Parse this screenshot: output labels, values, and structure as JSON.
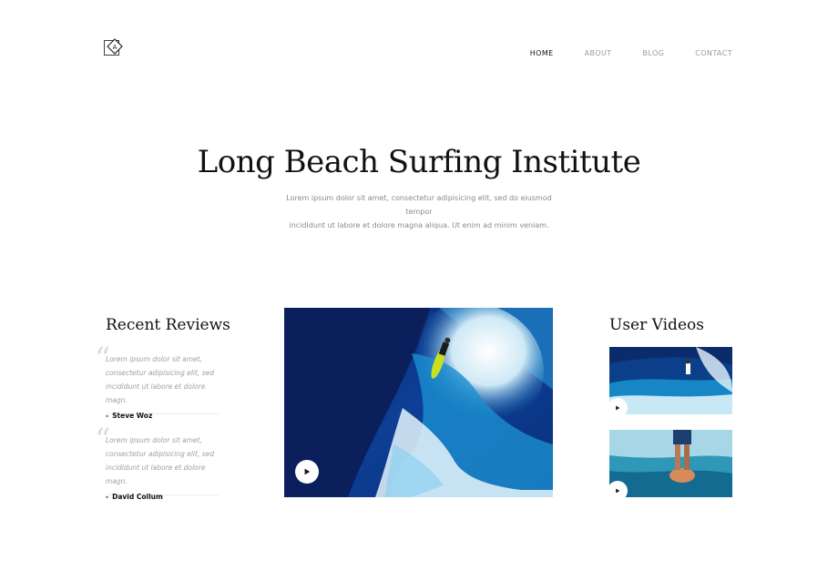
{
  "nav": {
    "items": [
      {
        "label": "HOME",
        "active": true
      },
      {
        "label": "ABOUT",
        "active": false
      },
      {
        "label": "BLOG",
        "active": false
      },
      {
        "label": "CONTACT",
        "active": false
      }
    ]
  },
  "hero": {
    "title": "Long Beach Surfing Institute",
    "subtitle_line1": "Lorem ipsum dolor sit amet, consectetur adipisicing elit, sed do eiusmod tempor",
    "subtitle_line2": "incididunt ut labore et dolore magna aliqua. Ut enim ad minim veniam."
  },
  "reviews": {
    "title": "Recent Reviews",
    "items": [
      {
        "text": "Lorem ipsum dolor sit amet, consectetur adipisicing elit, sed incididunt ut labore et dolore magn.",
        "author": "Steve Woz"
      },
      {
        "text": "Lorem ipsum dolor sit amet, consectetur adipisicing elit, sed incididunt ut labore et dolore magn.",
        "author": "David Collum"
      }
    ]
  },
  "videos": {
    "title": "User Videos"
  },
  "colors": {
    "accent": "#111111",
    "muted": "#9a9a9a",
    "ocean_dark": "#0b2a6b",
    "ocean_light": "#1e88c7"
  },
  "icons": [
    "logo-icon",
    "quote-icon",
    "play-icon"
  ]
}
